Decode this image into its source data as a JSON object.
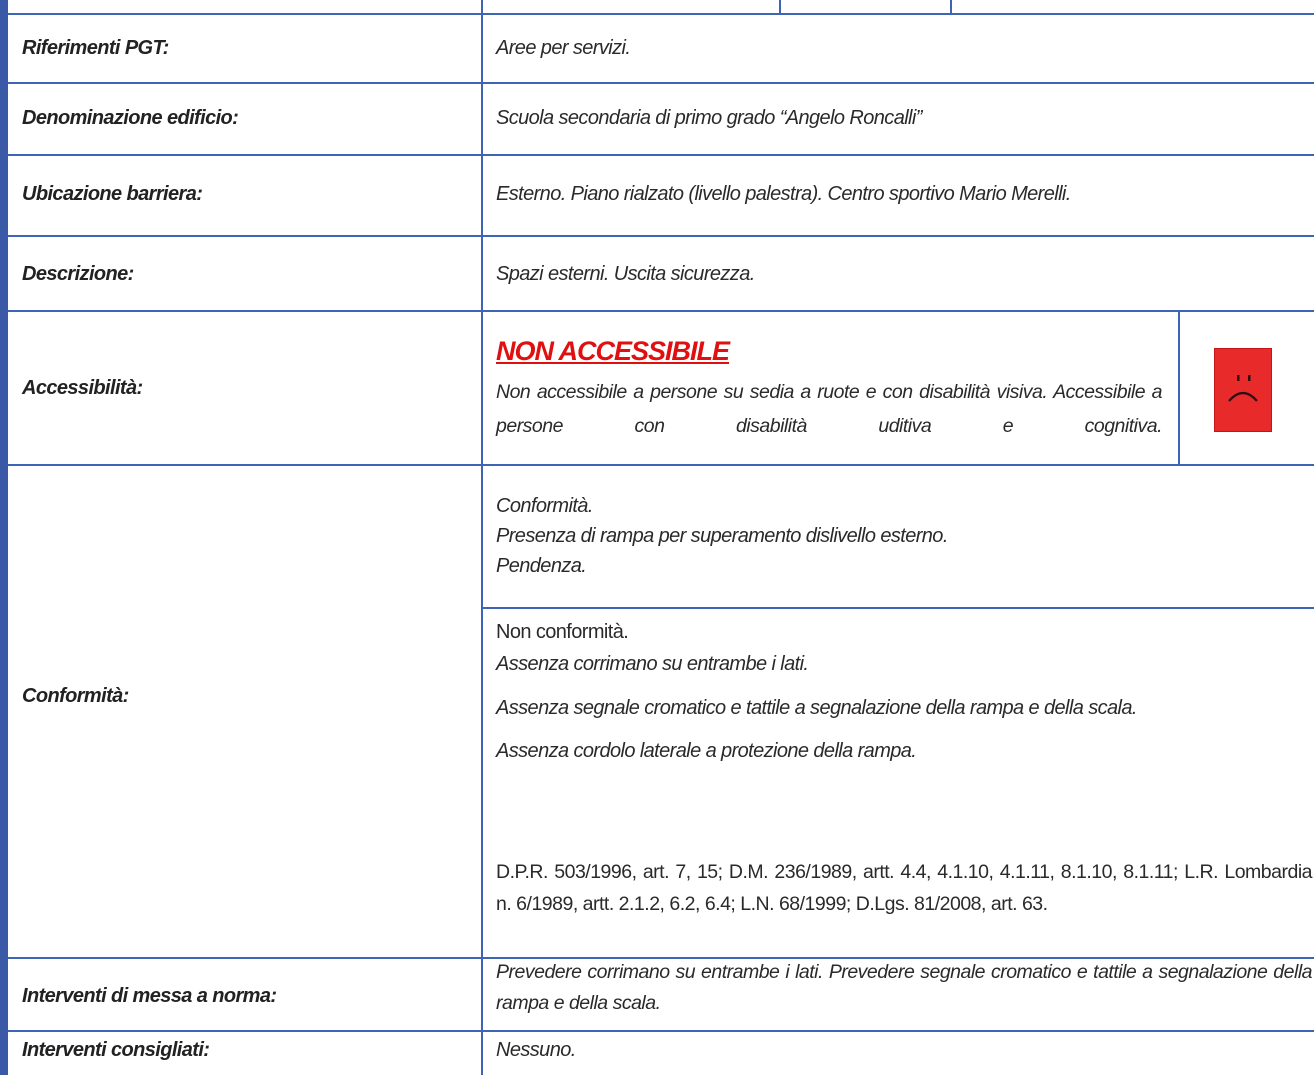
{
  "rows": {
    "riferimenti": {
      "label": "Riferimenti PGT:",
      "value": "Aree per servizi."
    },
    "denominazione": {
      "label": "Denominazione edificio:",
      "value": "Scuola secondaria di primo grado “Angelo Roncalli”"
    },
    "ubicazione": {
      "label": "Ubicazione barriera:",
      "value": "Esterno. Piano rialzato (livello palestra). Centro sportivo Mario Merelli."
    },
    "descrizione": {
      "label": "Descrizione:",
      "value": "Spazi esterni. Uscita sicurezza."
    },
    "accessibilita": {
      "label": "Accessibilità:",
      "status": "NON ACCESSIBILE",
      "text": "Non accessibile a persone su sedia a ruote e con disabilità visiva.  Accessibile a persone con disabilità uditiva e cognitiva.",
      "icon": "sad-face-icon",
      "status_color": "#e01010",
      "icon_color": "#e82a2a"
    },
    "conformita": {
      "label": "Conformità:",
      "conf_title": "Conformità.",
      "conf_items": [
        "Presenza di rampa per superamento dislivello esterno.",
        "Pendenza."
      ],
      "nonconf_title": "Non conformità.",
      "nonconf_items": [
        "Assenza corrimano su entrambe i lati.",
        "Assenza segnale cromatico e tattile a segnalazione della rampa e della scala.",
        "Assenza cordolo laterale a protezione della rampa."
      ],
      "norms": "D.P.R. 503/1996, art. 7, 15; D.M. 236/1989, artt. 4.4, 4.1.10, 4.1.11, 8.1.10, 8.1.11; L.R. Lombardia n. 6/1989, artt. 2.1.2, 6.2, 6.4; L.N. 68/1999; D.Lgs. 81/2008, art. 63."
    },
    "interventi_norma": {
      "label": "Interventi di messa a norma:",
      "value": "Prevedere corrimano su entrambe i lati. Prevedere segnale cromatico e tattile a segnalazione della rampa e della scala."
    },
    "interventi_consigliati": {
      "label": "Interventi consigliati:",
      "value": "Nessuno."
    }
  },
  "colors": {
    "border": "#3f64b4",
    "left_bar": "#3a5aa8"
  }
}
